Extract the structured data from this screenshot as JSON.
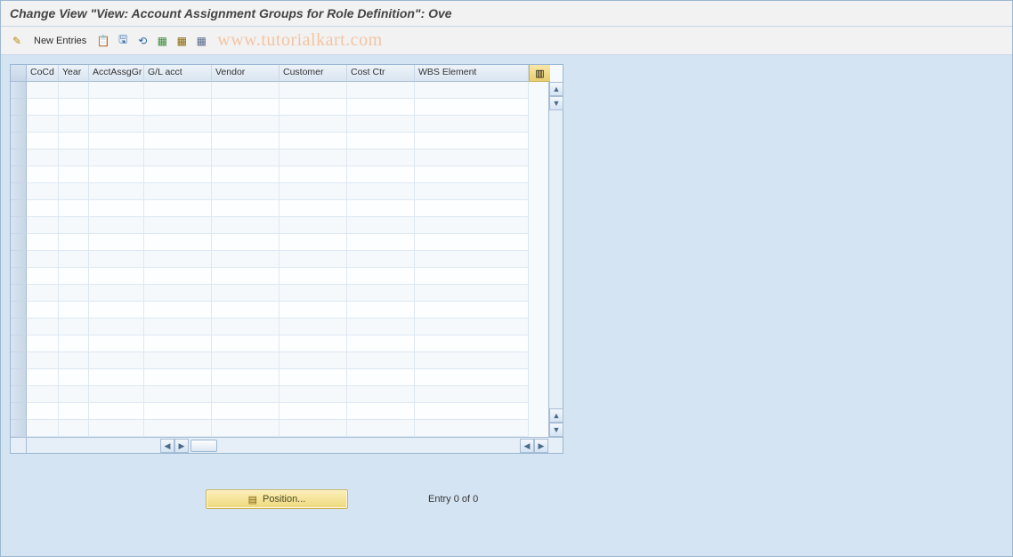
{
  "title": "Change View \"View: Account Assignment Groups for Role Definition\": Ove",
  "watermark": "www.tutorialkart.com",
  "toolbar": {
    "new_entries": "New Entries"
  },
  "grid": {
    "columns": [
      {
        "key": "cocd",
        "label": "CoCd"
      },
      {
        "key": "year",
        "label": "Year"
      },
      {
        "key": "aag",
        "label": "AcctAssgGr"
      },
      {
        "key": "gl",
        "label": "G/L acct"
      },
      {
        "key": "vendor",
        "label": "Vendor"
      },
      {
        "key": "cust",
        "label": "Customer"
      },
      {
        "key": "cctr",
        "label": "Cost Ctr"
      },
      {
        "key": "wbs",
        "label": "WBS Element"
      }
    ],
    "rows": [
      {},
      {},
      {},
      {},
      {},
      {},
      {},
      {},
      {},
      {},
      {},
      {},
      {},
      {},
      {},
      {},
      {},
      {},
      {},
      {},
      {}
    ]
  },
  "footer": {
    "position_label": "Position...",
    "entry_status": "Entry 0 of 0"
  }
}
